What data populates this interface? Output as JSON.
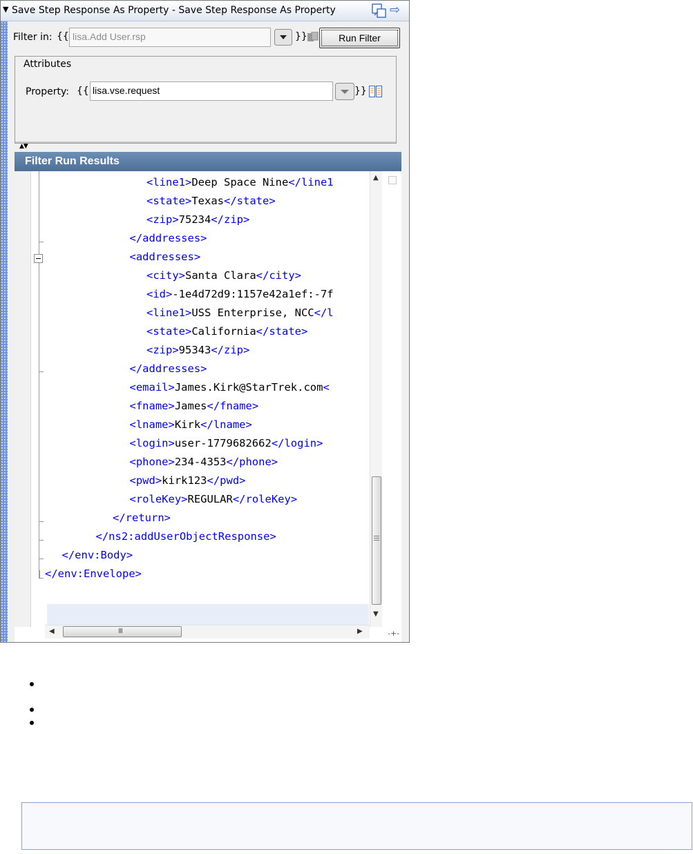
{
  "panel": {
    "title": "Save Step Response As Property - Save Step Response As Property",
    "icons": {
      "collapse": "collapse-triangle-icon",
      "detach": "detach-window-icon",
      "goto": "goto-arrow-icon"
    }
  },
  "filter": {
    "label": "Filter in:",
    "brace_open": "{{",
    "brace_close": "}}",
    "value": "lisa.Add User.rsp",
    "run_button": "Run Filter"
  },
  "attributes": {
    "legend": "Attributes",
    "property_label": "Property:",
    "brace_open": "{{",
    "brace_close": "}}",
    "property_value": "lisa.vse.request"
  },
  "results": {
    "header": "Filter Run Results",
    "lines": [
      {
        "indent": 6,
        "parts": [
          [
            "tag",
            "<line1>"
          ],
          [
            "txt",
            "Deep Space Nine"
          ],
          [
            "tag",
            "</line1"
          ]
        ]
      },
      {
        "indent": 6,
        "parts": [
          [
            "tag",
            "<state>"
          ],
          [
            "txt",
            "Texas"
          ],
          [
            "tag",
            "</state>"
          ]
        ]
      },
      {
        "indent": 6,
        "parts": [
          [
            "tag",
            "<zip>"
          ],
          [
            "txt",
            "75234"
          ],
          [
            "tag",
            "</zip>"
          ]
        ]
      },
      {
        "indent": 5,
        "parts": [
          [
            "tag",
            "</addresses>"
          ]
        ]
      },
      {
        "indent": 5,
        "parts": [
          [
            "tag",
            "<addresses>"
          ]
        ]
      },
      {
        "indent": 6,
        "parts": [
          [
            "tag",
            "<city>"
          ],
          [
            "txt",
            "Santa Clara"
          ],
          [
            "tag",
            "</city>"
          ]
        ]
      },
      {
        "indent": 6,
        "parts": [
          [
            "tag",
            "<id>"
          ],
          [
            "txt",
            "-1e4d72d9:1157e42a1ef:-7f"
          ]
        ]
      },
      {
        "indent": 6,
        "parts": [
          [
            "tag",
            "<line1>"
          ],
          [
            "txt",
            "USS Enterprise, NCC"
          ],
          [
            "tag",
            "</l"
          ]
        ]
      },
      {
        "indent": 6,
        "parts": [
          [
            "tag",
            "<state>"
          ],
          [
            "txt",
            "California"
          ],
          [
            "tag",
            "</state>"
          ]
        ]
      },
      {
        "indent": 6,
        "parts": [
          [
            "tag",
            "<zip>"
          ],
          [
            "txt",
            "95343"
          ],
          [
            "tag",
            "</zip>"
          ]
        ]
      },
      {
        "indent": 5,
        "parts": [
          [
            "tag",
            "</addresses>"
          ]
        ]
      },
      {
        "indent": 5,
        "parts": [
          [
            "tag",
            "<email>"
          ],
          [
            "txt",
            "James.Kirk@StarTrek.com"
          ],
          [
            "tag",
            "<"
          ]
        ]
      },
      {
        "indent": 5,
        "parts": [
          [
            "tag",
            "<fname>"
          ],
          [
            "txt",
            "James"
          ],
          [
            "tag",
            "</fname>"
          ]
        ]
      },
      {
        "indent": 5,
        "parts": [
          [
            "tag",
            "<lname>"
          ],
          [
            "txt",
            "Kirk"
          ],
          [
            "tag",
            "</lname>"
          ]
        ]
      },
      {
        "indent": 5,
        "parts": [
          [
            "tag",
            "<login>"
          ],
          [
            "txt",
            "user-1779682662"
          ],
          [
            "tag",
            "</login>"
          ]
        ]
      },
      {
        "indent": 5,
        "parts": [
          [
            "tag",
            "<phone>"
          ],
          [
            "txt",
            "234-4353"
          ],
          [
            "tag",
            "</phone>"
          ]
        ]
      },
      {
        "indent": 5,
        "parts": [
          [
            "tag",
            "<pwd>"
          ],
          [
            "txt",
            "kirk123"
          ],
          [
            "tag",
            "</pwd>"
          ]
        ]
      },
      {
        "indent": 5,
        "parts": [
          [
            "tag",
            "<roleKey>"
          ],
          [
            "txt",
            "REGULAR"
          ],
          [
            "tag",
            "</roleKey>"
          ]
        ]
      },
      {
        "indent": 4,
        "parts": [
          [
            "tag",
            "</return>"
          ]
        ]
      },
      {
        "indent": 3,
        "parts": [
          [
            "tag",
            "</ns2:addUserObjectResponse>"
          ]
        ]
      },
      {
        "indent": 1,
        "parts": [
          [
            "tag",
            "</env:Body>"
          ]
        ]
      },
      {
        "indent": 0,
        "parts": [
          [
            "tag",
            "</env:Envelope>"
          ]
        ]
      }
    ],
    "hscroll_grip": "III"
  },
  "colors": {
    "tag": "#0000ff",
    "text": "#000000",
    "header_bg": "#5a7aa5",
    "panel_bg": "#f0f0f0"
  }
}
